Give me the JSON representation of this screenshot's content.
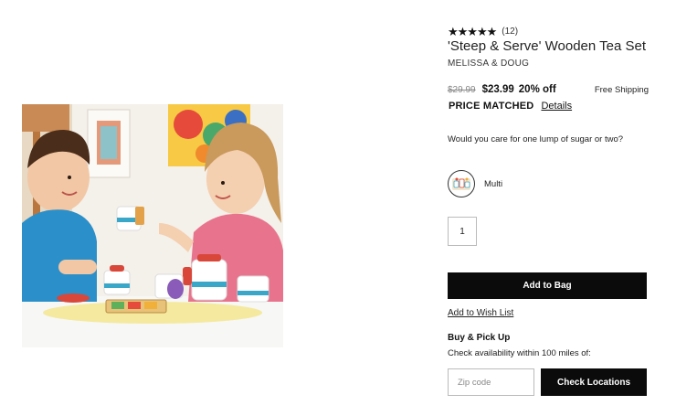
{
  "product": {
    "rating_stars": "★★★★★",
    "review_count": "(12)",
    "title": "'Steep & Serve' Wooden Tea Set",
    "brand": "MELISSA & DOUG",
    "rating_value": 4.5
  },
  "pricing": {
    "original_price": "$29.99",
    "sale_price": "$23.99",
    "discount": "20% off",
    "shipping": "Free Shipping",
    "price_matched_label": "PRICE MATCHED",
    "details_link": "Details"
  },
  "tagline": "Would you care for one lump of sugar or two?",
  "color_option": {
    "label": "Multi",
    "swatch_icon": "tea-set-swatch-icon"
  },
  "quantity": {
    "value": "1"
  },
  "actions": {
    "add_to_bag": "Add to Bag",
    "wish_list": "Add to Wish List"
  },
  "pickup": {
    "heading": "Buy & Pick Up",
    "subtext": "Check availability within 100 miles of:",
    "zip_placeholder": "Zip code",
    "check_button": "Check Locations"
  },
  "colors": {
    "button_bg": "#0b0b0b",
    "button_text": "#ffffff",
    "shirt_blue": "#2b8fc9",
    "shirt_pink": "#e8738d",
    "wall": "#f3efe9"
  }
}
